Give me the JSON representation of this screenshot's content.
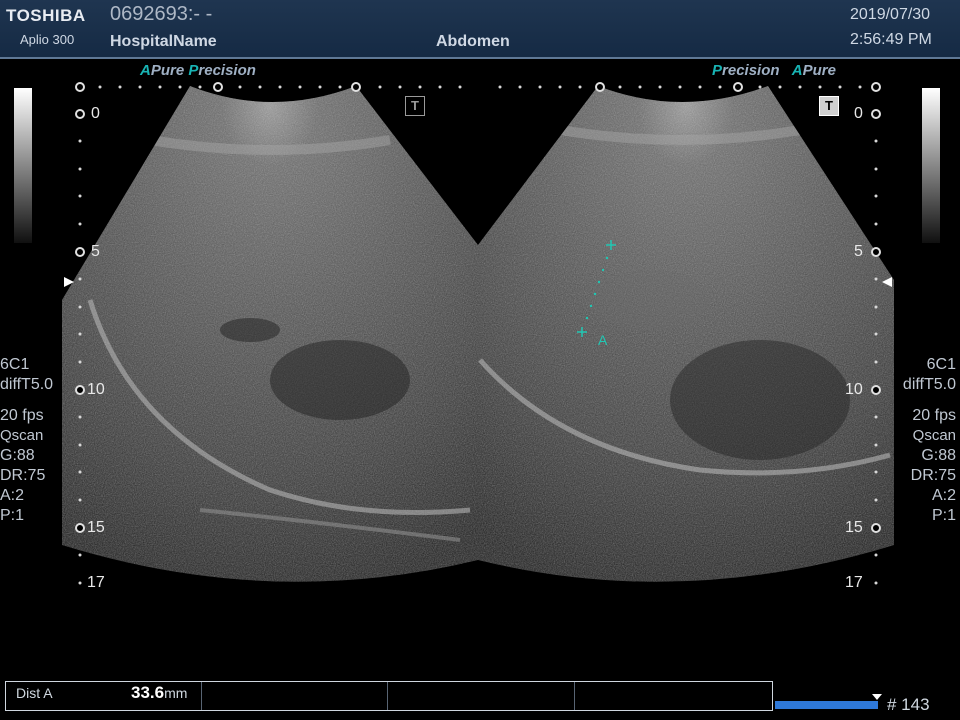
{
  "header": {
    "brand": "TOSHIBA",
    "model": "Aplio 300",
    "patient_id": "0692693:- -",
    "hospital": "HospitalName",
    "exam": "Abdomen",
    "date": "2019/07/30",
    "time": "2:56:49 PM"
  },
  "left_view": {
    "mode_a": "A",
    "mode_a_word": "Pure",
    "mode_p": "P",
    "mode_p_word": "recision",
    "t_icon": "T"
  },
  "right_view": {
    "mode_p": "P",
    "mode_p_word": "recision",
    "mode_a": "A",
    "mode_a_word": "Pure",
    "t_icon": "T",
    "caliper_label": "A"
  },
  "depth_labels": [
    "0",
    "5",
    "10",
    "15",
    "17"
  ],
  "params_left": {
    "probe": "6C1",
    "filter": "diffT5.0",
    "fps": "20 fps",
    "q_letter": "Q",
    "scan": "scan",
    "gain": "G:88",
    "dr": "DR:75",
    "a": "A:2",
    "p": "P:1"
  },
  "params_right": {
    "probe": "6C1",
    "filter": "diffT5.0",
    "fps": "20 fps",
    "q_letter": "Q",
    "scan": "scan",
    "gain": "G:88",
    "dr": "DR:75",
    "a": "A:2",
    "p": "P:1"
  },
  "measurement": {
    "label": "Dist A",
    "value": "33.6",
    "unit": "mm"
  },
  "frame": {
    "number": "# 143",
    "progress": 1.0
  },
  "colors": {
    "accent": "#18b4b4",
    "header_bg": "#1f3550",
    "frame_bar": "#2e78d8"
  }
}
